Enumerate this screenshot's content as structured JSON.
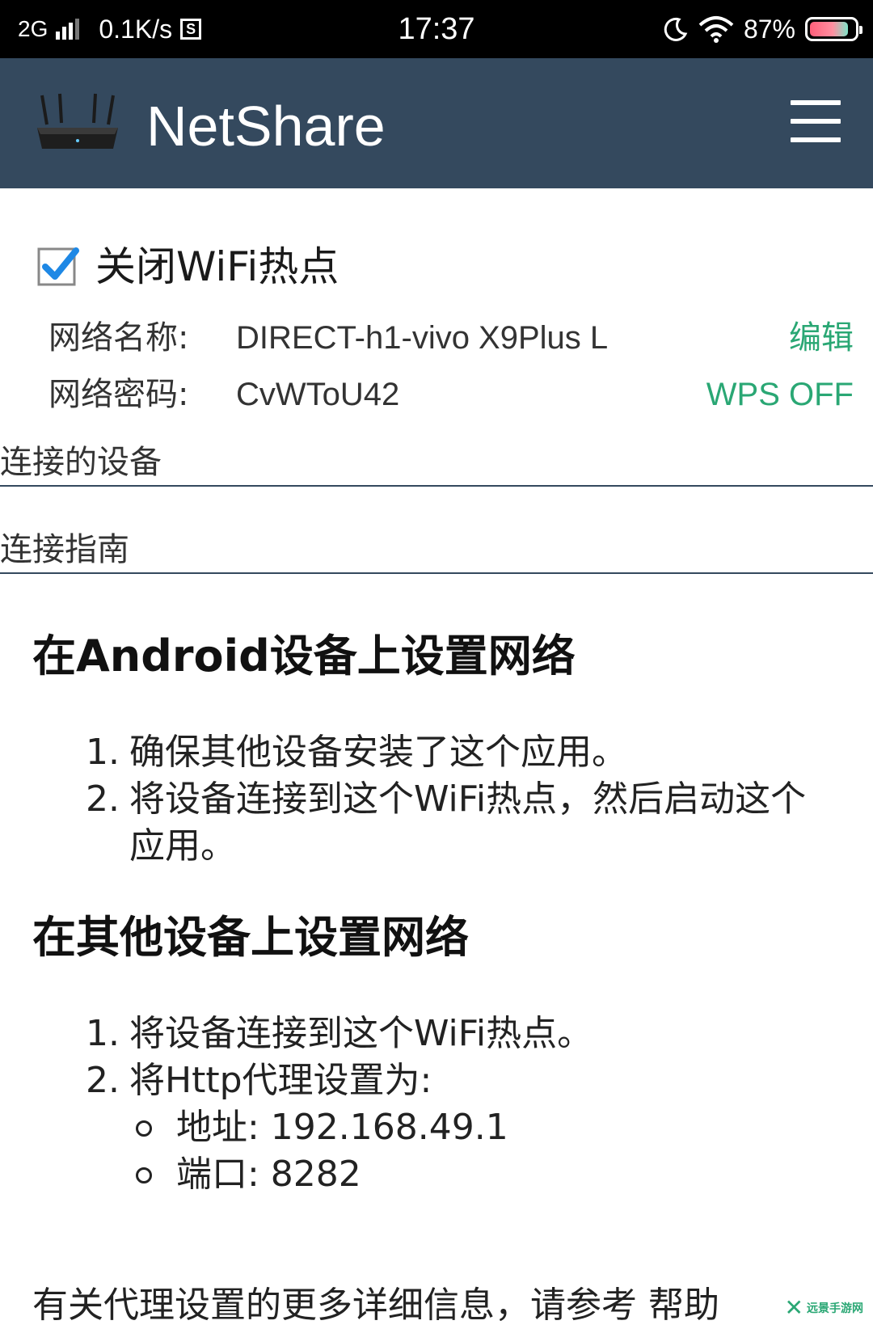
{
  "status_bar": {
    "network_type": "2G",
    "data_speed": "0.1K/s",
    "sim_badge": "S",
    "time": "17:37",
    "battery": "87%",
    "battery_level": 0.87
  },
  "app_bar": {
    "title": "NetShare",
    "menu_icon": "hamburger-menu-icon",
    "logo_icon": "router-icon"
  },
  "hotspot": {
    "toggle_label": "关闭WiFi热点",
    "checked": true,
    "ssid_label": "网络名称:",
    "ssid_value": "DIRECT-h1-vivo X9Plus L",
    "edit_label": "编辑",
    "password_label": "网络密码:",
    "password_value": "CvWToU42",
    "wps_label": "WPS OFF"
  },
  "sections": {
    "connected_devices": "连接的设备",
    "guide": "连接指南"
  },
  "guide": {
    "android_heading": "在Android设备上设置网络",
    "android_steps": [
      {
        "num": "1.",
        "text": "确保其他设备安装了这个应用。"
      },
      {
        "num": "2.",
        "text": "将设备连接到这个WiFi热点，然后启动这个应用。"
      }
    ],
    "other_heading": "在其他设备上设置网络",
    "other_steps": [
      {
        "num": "1.",
        "text": "将设备连接到这个WiFi热点。"
      },
      {
        "num": "2.",
        "text": "将Http代理设置为:"
      }
    ],
    "proxy": [
      {
        "text": "地址: 192.168.49.1"
      },
      {
        "text": "端口: 8282"
      }
    ],
    "more_info": "有关代理设置的更多详细信息，请参考",
    "help_link": "帮助"
  },
  "watermark": {
    "text": "远景手游网"
  },
  "colors": {
    "app_bar": "#34495e",
    "accent": "#2aa774",
    "checkbox_check": "#1e88e5"
  }
}
